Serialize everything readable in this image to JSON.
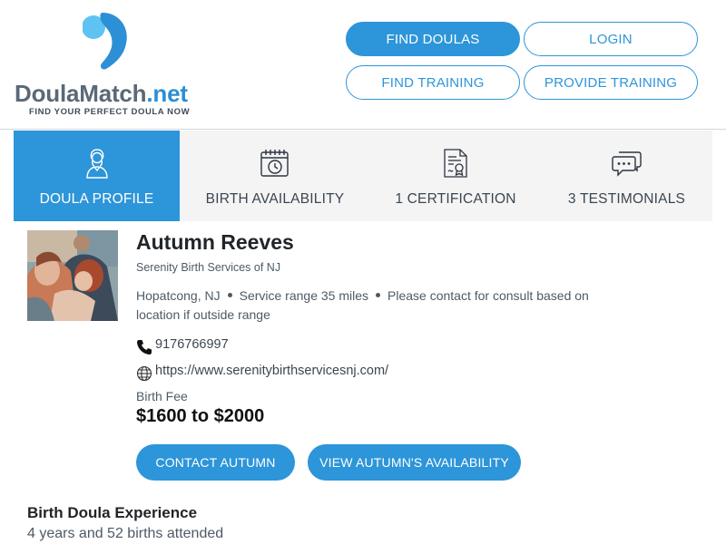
{
  "header": {
    "logo_text_part1": "Doula",
    "logo_text_part2": "Match",
    "logo_text_part3": ".net",
    "logo_tagline": "FIND YOUR PERFECT DOULA NOW",
    "nav": {
      "find_doulas": "FIND DOULAS",
      "login": "LOGIN",
      "find_training": "FIND TRAINING",
      "provide_training": "PROVIDE TRAINING"
    }
  },
  "tabs": [
    {
      "label": "DOULA PROFILE",
      "icon": "doula-person-icon",
      "active": true
    },
    {
      "label": "BIRTH AVAILABILITY",
      "icon": "calendar-clock-icon",
      "active": false
    },
    {
      "label": "1 CERTIFICATION",
      "icon": "certificate-icon",
      "active": false
    },
    {
      "label": "3 TESTIMONIALS",
      "icon": "chat-bubbles-icon",
      "active": false
    }
  ],
  "profile": {
    "name": "Autumn Reeves",
    "company": "Serenity Birth Services of NJ",
    "city": "Hopatcong, NJ",
    "service_range": "Service range 35 miles",
    "contact_note": "Please contact for consult based on location if outside range",
    "phone": "9176766997",
    "website": "https://www.serenitybirthservicesnj.com/",
    "fee_label": "Birth Fee",
    "fee_value": "$1600 to $2000",
    "contact_button": "CONTACT AUTUMN",
    "availability_button": "VIEW AUTUMN'S AVAILABILITY"
  },
  "experience": {
    "title": "Birth Doula Experience",
    "text": "4 years and 52 births attended"
  },
  "colors": {
    "accent": "#2d95d9",
    "tab_bg": "#f4f4f4",
    "logo_gray": "#5b6877"
  }
}
